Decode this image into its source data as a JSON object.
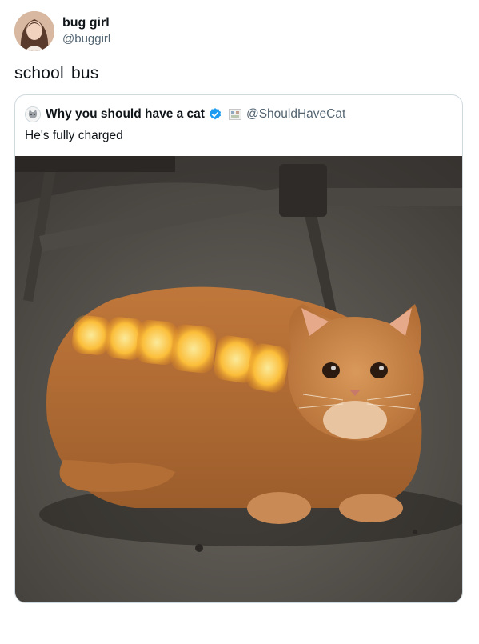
{
  "tweet": {
    "author": {
      "display_name": "bug girl",
      "handle": "@buggirl",
      "avatar_icon": "user-avatar"
    },
    "text": "school  bus"
  },
  "quote": {
    "author": {
      "display_name": "Why you should have a cat",
      "handle": "@ShouldHaveCat",
      "verified": true,
      "avatar_icon": "cat-avatar"
    },
    "text": "He's fully charged",
    "image": {
      "description_icon": "cat-photo",
      "subject": "orange cat with glowing light stripes"
    }
  },
  "colors": {
    "text_primary": "#0f1419",
    "text_secondary": "#536471",
    "border": "#cfd9de",
    "verified_blue": "#1d9bf0"
  }
}
